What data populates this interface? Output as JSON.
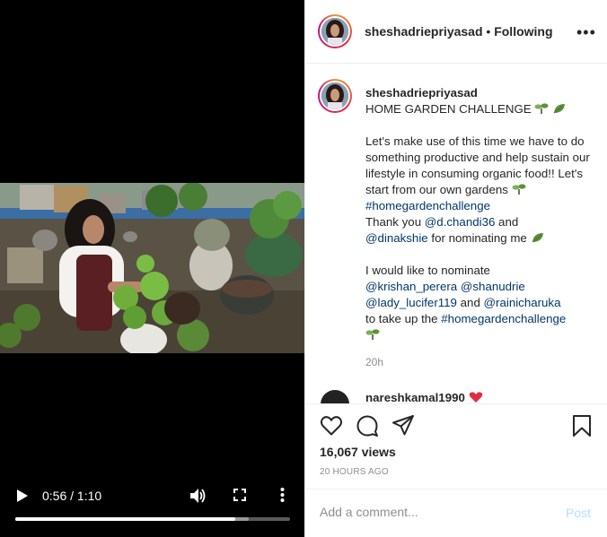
{
  "video": {
    "time_display": "0:56 / 1:10",
    "progress_fraction": 0.8,
    "buffered_fraction": 0.85
  },
  "header": {
    "username": "sheshadriepriyasad",
    "separator": "•",
    "follow_status": "Following",
    "more_label": "•••"
  },
  "caption": {
    "username": "sheshadriepriyasad",
    "line1": "HOME GARDEN CHALLENGE",
    "para1": "Let's make use of this time we have to do something productive and help sustain our lifestyle in consuming organic food!! Let's start from our own gardens",
    "hashtag1": "#homegardenchallenge",
    "thanks_pre": "Thank you ",
    "mention1": "@d.chandi36",
    "thanks_mid": " and",
    "mention2": "@dinakshie",
    "thanks_post": " for nominating me",
    "nominate_pre": "I would like to nominate",
    "mention3": "@krishan_perera",
    "mention4": "@shanudrie",
    "mention5": "@lady_lucifer119",
    "and_text": " and ",
    "mention6": "@rainicharuka",
    "take_up": "to take up the ",
    "hashtag2": "#homegardenchallenge"
  },
  "timestamp": "20h",
  "next_comment": {
    "username": "nareshkamal1990"
  },
  "stats": {
    "views": "16,067 views",
    "posted_ago": "20 HOURS AGO"
  },
  "comment_box": {
    "placeholder": "Add a comment...",
    "post_label": "Post"
  },
  "colors": {
    "link": "#00376b",
    "muted": "#8e8e8e",
    "post_disabled": "#b2dffc"
  },
  "icons": [
    "play-icon",
    "volume-icon",
    "fullscreen-icon",
    "kebab-icon",
    "heart-icon",
    "comment-icon",
    "share-icon",
    "bookmark-icon",
    "seedling-emoji",
    "leaf-emoji"
  ]
}
